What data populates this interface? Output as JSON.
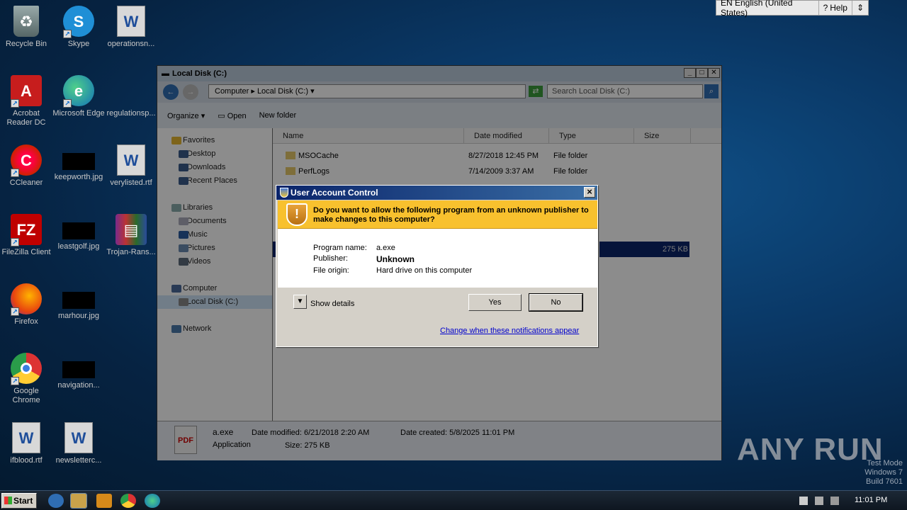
{
  "desktop": {
    "icons": [
      {
        "label": "Recycle Bin",
        "icon": "recycle-bin-icon"
      },
      {
        "label": "Skype",
        "icon": "skype-icon"
      },
      {
        "label": "operationsn...",
        "icon": "word-doc-icon"
      },
      {
        "label": "Acrobat Reader DC",
        "icon": "acrobat-icon"
      },
      {
        "label": "Microsoft Edge",
        "icon": "edge-icon"
      },
      {
        "label": "regulationsp...",
        "icon": "file-icon"
      },
      {
        "label": "CCleaner",
        "icon": "ccleaner-icon"
      },
      {
        "label": "keepworth.jpg",
        "icon": "image-thumb-icon"
      },
      {
        "label": "verylisted.rtf",
        "icon": "word-doc-icon"
      },
      {
        "label": "FileZilla Client",
        "icon": "filezilla-icon"
      },
      {
        "label": "leastgolf.jpg",
        "icon": "image-thumb-icon"
      },
      {
        "label": "Trojan-Rans...",
        "icon": "winrar-icon"
      },
      {
        "label": "Firefox",
        "icon": "firefox-icon"
      },
      {
        "label": "marhour.jpg",
        "icon": "image-thumb-icon"
      },
      {
        "label": "Google Chrome",
        "icon": "chrome-icon"
      },
      {
        "label": "navigation...",
        "icon": "image-thumb-icon"
      },
      {
        "label": "ifblood.rtf",
        "icon": "word-doc-icon"
      },
      {
        "label": "newsletterc...",
        "icon": "word-doc-icon"
      }
    ]
  },
  "langbar": {
    "language": "EN English (United States)",
    "help": "Help"
  },
  "explorer": {
    "title": "Local Disk (C:)",
    "breadcrumb": [
      "Computer",
      "Local Disk (C:)"
    ],
    "search_placeholder": "Search Local Disk (C:)",
    "commands": {
      "organize": "Organize",
      "open": "Open",
      "new_folder": "New folder"
    },
    "nav": {
      "favorites": "Favorites",
      "favorites_items": [
        "Desktop",
        "Downloads",
        "Recent Places"
      ],
      "libraries": "Libraries",
      "libraries_items": [
        "Documents",
        "Music",
        "Pictures",
        "Videos"
      ],
      "computer": "Computer",
      "computer_items": [
        "Local Disk (C:)"
      ],
      "network": "Network"
    },
    "columns": [
      "Name",
      "Date modified",
      "Type",
      "Size"
    ],
    "files": [
      {
        "name": "MSOCache",
        "date": "8/27/2018 12:45 PM",
        "type": "File folder",
        "size": ""
      },
      {
        "name": "PerfLogs",
        "date": "7/14/2009 3:37 AM",
        "type": "File folder",
        "size": ""
      }
    ],
    "selected_size": "275 KB",
    "details": {
      "name": "a.exe",
      "kind": "Application",
      "date_modified": "Date modified: 6/21/2018 2:20 AM",
      "size": "Size: 275 KB",
      "date_created": "Date created: 5/8/2025 11:01 PM"
    }
  },
  "uac": {
    "title": "User Account Control",
    "question": "Do you want to allow the following program from an unknown publisher to make changes to this computer?",
    "program_name_label": "Program name:",
    "program_name": "a.exe",
    "publisher_label": "Publisher:",
    "publisher": "Unknown",
    "file_origin_label": "File origin:",
    "file_origin": "Hard drive on this computer",
    "show_details": "Show details",
    "yes": "Yes",
    "no": "No",
    "change_link": "Change when these notifications appear"
  },
  "taskbar": {
    "start": "Start",
    "clock": "11:01 PM"
  },
  "watermark": {
    "line1": "Test Mode",
    "line2": "Windows 7",
    "line3": "Build 7601"
  },
  "brand": "ANY RUN"
}
